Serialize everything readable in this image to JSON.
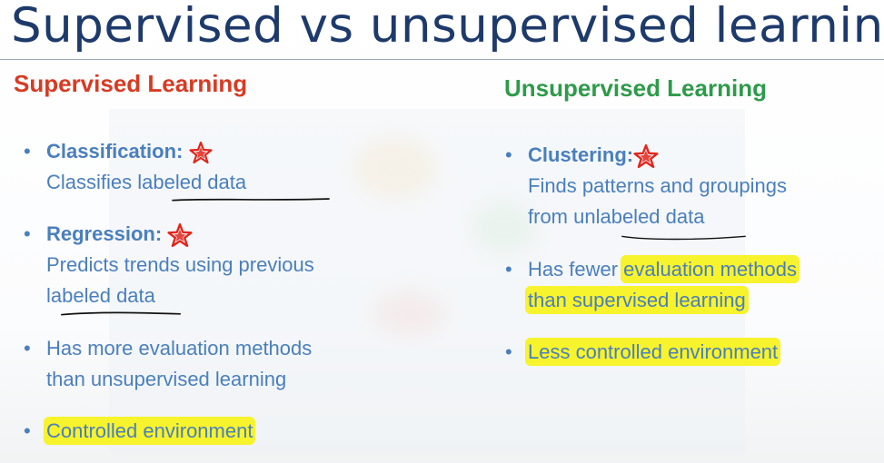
{
  "slide": {
    "title": "Supervised vs unsupervised learning"
  },
  "supervised": {
    "heading": "Supervised Learning",
    "items": [
      {
        "term": "Classification:",
        "line1": "Classifies labeled data"
      },
      {
        "term": "Regression:",
        "line1": "Predicts trends using previous",
        "line2": "labeled data"
      },
      {
        "line1": "Has more evaluation methods",
        "line2": "than unsupervised learning"
      },
      {
        "line1": "Controlled environment"
      }
    ]
  },
  "unsupervised": {
    "heading": "Unsupervised Learning",
    "items": [
      {
        "term": "Clustering:",
        "line1": "Finds patterns and groupings",
        "line2": "from unlabeled data"
      },
      {
        "line1a": "Has fewer ",
        "line1b": "evaluation methods",
        "line2": "than supervised learning"
      },
      {
        "line1": "Less controlled environment"
      }
    ]
  },
  "colors": {
    "title": "#1d3a6b",
    "supervised_heading": "#d83a23",
    "unsupervised_heading": "#2e9a4a",
    "body_text": "#4a7fbd",
    "highlight": "#f7f32c",
    "star": "#e1261c"
  },
  "icons": {
    "annotation_star": "star-icon",
    "bullet": "bullet-dot"
  }
}
